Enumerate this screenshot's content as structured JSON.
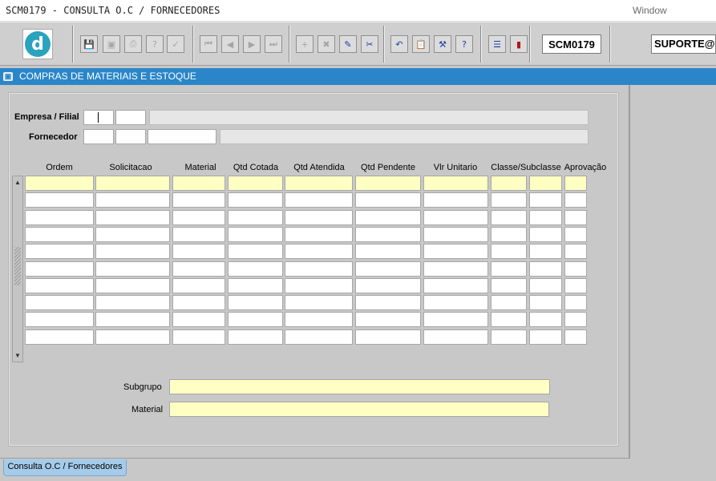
{
  "window": {
    "title": "SCM0179 - CONSULTA O.C / FORNECEDORES",
    "menu": "Window"
  },
  "toolbar": {
    "logo_letter": "d",
    "module_code": "SCM0179",
    "user": "SUPORTE@DES",
    "buttons": [
      {
        "name": "save-button",
        "icon": "save-icon",
        "glyph": "💾",
        "enabled": false
      },
      {
        "name": "print-preview-button",
        "icon": "screen-icon",
        "glyph": "▣",
        "enabled": false
      },
      {
        "name": "print-button",
        "icon": "printer-icon",
        "glyph": "⎙",
        "enabled": false
      },
      {
        "name": "enter-query-button",
        "icon": "query-icon",
        "glyph": "?",
        "enabled": false
      },
      {
        "name": "execute-query-button",
        "icon": "execute-query-icon",
        "glyph": "✓",
        "enabled": false
      },
      {
        "name": "first-record-button",
        "icon": "first-icon",
        "glyph": "⏮",
        "enabled": false
      },
      {
        "name": "previous-record-button",
        "icon": "previous-icon",
        "glyph": "◀",
        "enabled": false
      },
      {
        "name": "next-record-button",
        "icon": "next-icon",
        "glyph": "▶",
        "enabled": false
      },
      {
        "name": "last-record-button",
        "icon": "last-icon",
        "glyph": "⏭",
        "enabled": false
      },
      {
        "name": "insert-record-button",
        "icon": "plus-icon",
        "glyph": "+",
        "enabled": false
      },
      {
        "name": "delete-record-button",
        "icon": "x-icon",
        "glyph": "✖",
        "enabled": false
      },
      {
        "name": "edit-record-button",
        "icon": "edit-window-icon",
        "glyph": "✎",
        "enabled": true
      },
      {
        "name": "clear-button",
        "icon": "eraser-icon",
        "glyph": "✂",
        "enabled": true
      },
      {
        "name": "undo-button",
        "icon": "undo-icon",
        "glyph": "↶",
        "enabled": true
      },
      {
        "name": "clipboard-button",
        "icon": "clipboard-icon",
        "glyph": "📋",
        "enabled": false
      },
      {
        "name": "settings-button",
        "icon": "tools-icon",
        "glyph": "⚒",
        "enabled": true
      },
      {
        "name": "help-button",
        "icon": "help-icon",
        "glyph": "?",
        "enabled": true
      },
      {
        "name": "menu-button",
        "icon": "menu-icon",
        "glyph": "☰",
        "enabled": true
      },
      {
        "name": "exit-button",
        "icon": "exit-door-icon",
        "glyph": "▮",
        "enabled": true
      }
    ]
  },
  "form": {
    "window_title": "COMPRAS DE MATERIAIS E ESTOQUE",
    "empresa_label": "Empresa / Filial",
    "fornecedor_label": "Fornecedor",
    "subgrupo_label": "Subgrupo",
    "material_label": "Material",
    "columns": [
      "Ordem",
      "Solicitacao",
      "Material",
      "Qtd Cotada",
      "Qtd Atendida",
      "Qtd Pendente",
      "Vlr Unitario",
      "Classe/Subclasse",
      "Aprovação"
    ],
    "row_count": 10
  },
  "tabs": {
    "active": "Consulta O.C / Fornecedores"
  }
}
